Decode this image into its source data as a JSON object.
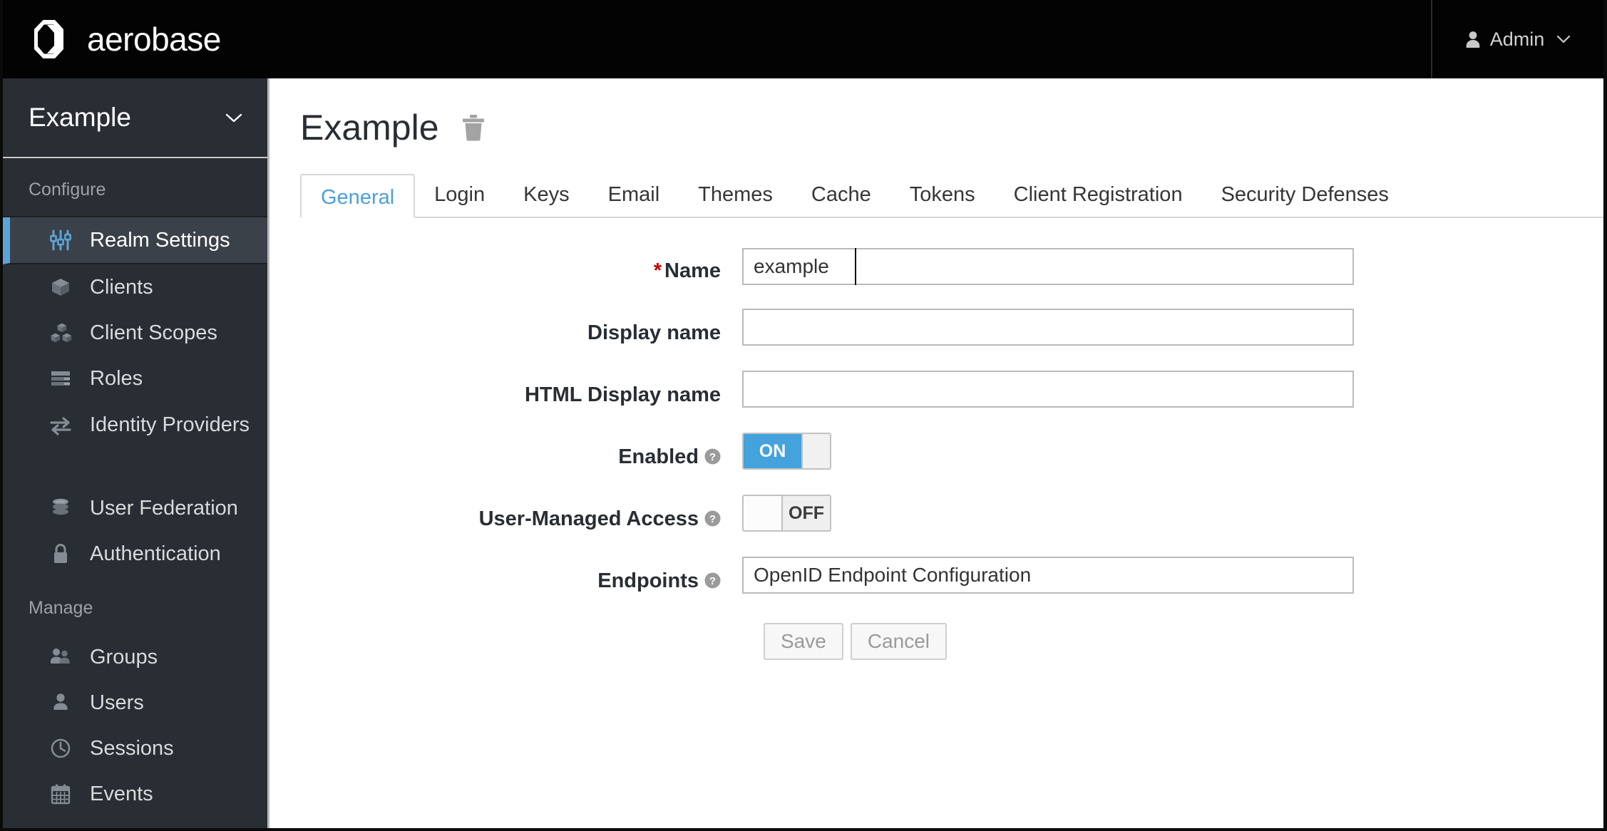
{
  "masthead": {
    "brand_name": "aerobase",
    "brand_icon": "aerobase-hexagon-logo",
    "user_label": "Admin",
    "user_icon": "user-avatar-icon",
    "caret_icon": "chevron-down-icon"
  },
  "sidebar": {
    "realm": {
      "name": "Example",
      "caret_icon": "chevron-down-icon"
    },
    "sections": [
      {
        "label": "Configure",
        "items": [
          {
            "label": "Realm Settings",
            "icon": "sliders-icon",
            "active": true
          },
          {
            "label": "Clients",
            "icon": "cube-icon",
            "active": false
          },
          {
            "label": "Client Scopes",
            "icon": "cubes-icon",
            "active": false
          },
          {
            "label": "Roles",
            "icon": "list-rows-icon",
            "active": false
          },
          {
            "label": "Identity Providers",
            "icon": "exchange-arrows-icon",
            "active": false
          },
          {
            "label": "User Federation",
            "icon": "database-icon",
            "active": false
          },
          {
            "label": "Authentication",
            "icon": "lock-icon",
            "active": false
          }
        ]
      },
      {
        "label": "Manage",
        "items": [
          {
            "label": "Groups",
            "icon": "users-group-icon",
            "active": false
          },
          {
            "label": "Users",
            "icon": "user-icon",
            "active": false
          },
          {
            "label": "Sessions",
            "icon": "clock-icon",
            "active": false
          },
          {
            "label": "Events",
            "icon": "calendar-icon",
            "active": false
          }
        ]
      }
    ]
  },
  "main": {
    "page_title": "Example",
    "delete_icon": "trash-icon",
    "tabs": [
      {
        "label": "General",
        "active": true
      },
      {
        "label": "Login",
        "active": false
      },
      {
        "label": "Keys",
        "active": false
      },
      {
        "label": "Email",
        "active": false
      },
      {
        "label": "Themes",
        "active": false
      },
      {
        "label": "Cache",
        "active": false
      },
      {
        "label": "Tokens",
        "active": false
      },
      {
        "label": "Client Registration",
        "active": false
      },
      {
        "label": "Security Defenses",
        "active": false
      }
    ],
    "form": {
      "name": {
        "label": "Name",
        "required_marker": "*",
        "value": "example",
        "placeholder": ""
      },
      "display_name": {
        "label": "Display name",
        "value": "",
        "placeholder": ""
      },
      "html_display_name": {
        "label": "HTML Display name",
        "value": "",
        "placeholder": ""
      },
      "enabled": {
        "label": "Enabled",
        "help_icon": "question-circle-icon",
        "state": "ON"
      },
      "user_managed_access": {
        "label": "User-Managed Access",
        "help_icon": "question-circle-icon",
        "state": "OFF"
      },
      "endpoints": {
        "label": "Endpoints",
        "help_icon": "question-circle-icon",
        "value": "OpenID Endpoint Configuration"
      },
      "save_label": "Save",
      "cancel_label": "Cancel"
    }
  },
  "colors": {
    "masthead_bg": "#030303",
    "sidebar_bg": "#292e34",
    "sidebar_active_bg": "#3b4148",
    "accent_blue": "#5ba4d6",
    "tab_active": "#4d9fd7",
    "toggle_on": "#44a2dd",
    "required_red": "#cc0000"
  }
}
